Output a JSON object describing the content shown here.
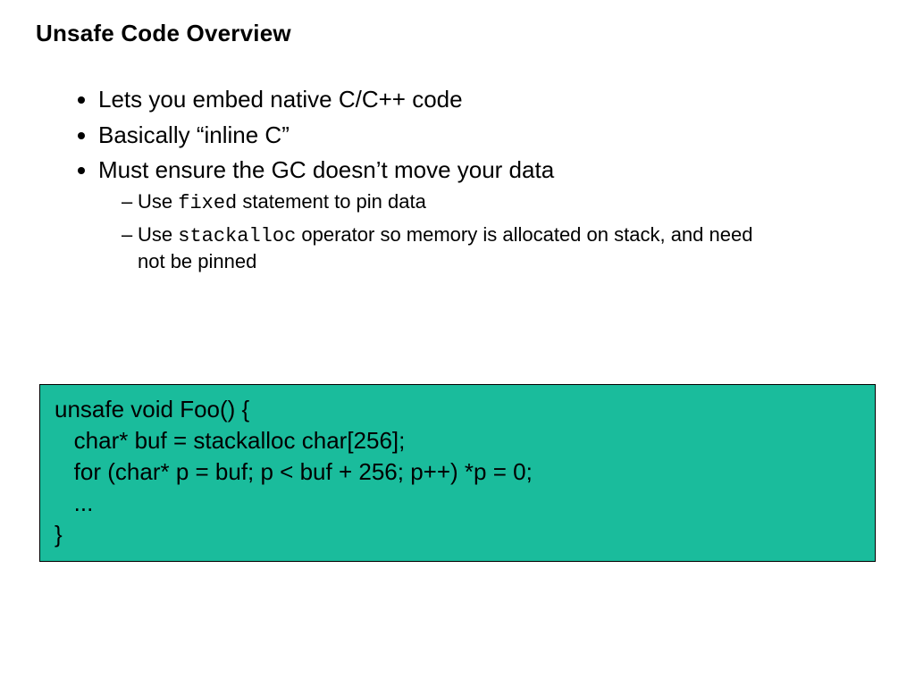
{
  "title": "Unsafe Code Overview",
  "bullets": {
    "b0": "Lets you embed native C/C++ code",
    "b1_pre": "Basically ",
    "b1_quote": "“inline C”",
    "b2_pre": "Must ensure the GC doesn",
    "b2_apos": "’",
    "b2_post": "t move your data",
    "sub0_pre": "Use ",
    "sub0_code": "fixed",
    "sub0_post": " statement to pin data",
    "sub1_pre": "Use ",
    "sub1_code": "stackalloc",
    "sub1_post": " operator so memory is allocated on stack, and need not be pinned"
  },
  "code": "unsafe void Foo() {\n   char* buf = stackalloc char[256];\n   for (char* p = buf; p < buf + 256; p++) *p = 0;\n   ...\n}"
}
